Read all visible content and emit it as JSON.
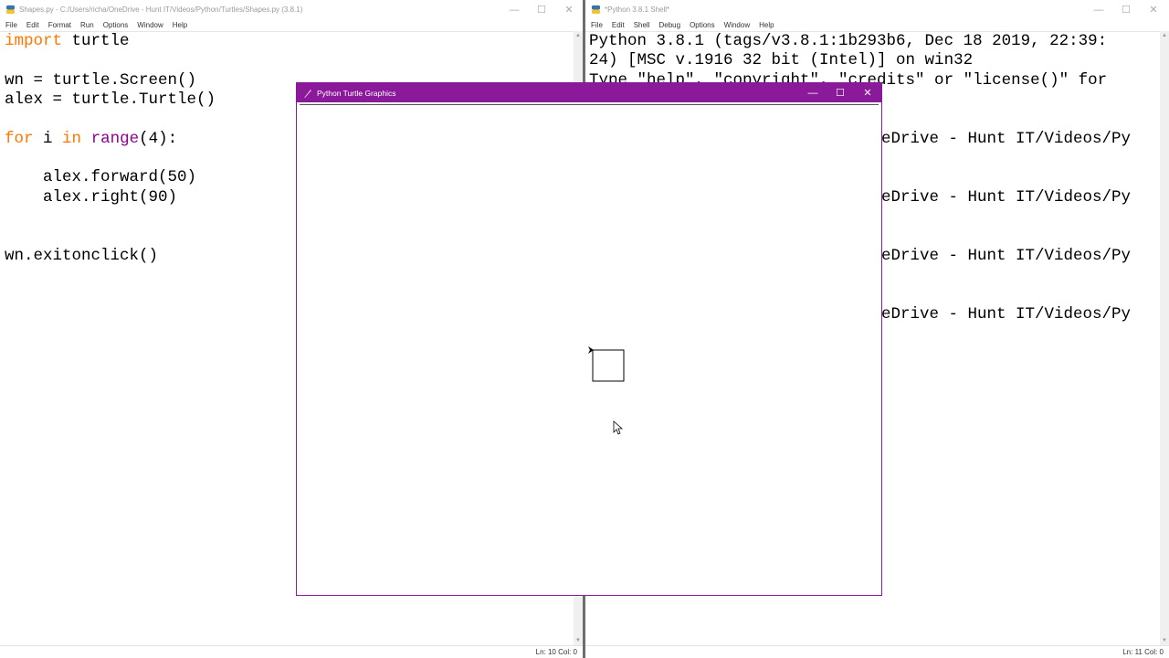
{
  "editor": {
    "title": "Shapes.py - C:/Users/richa/OneDrive - Hunt IT/Videos/Python/Turtles/Shapes.py (3.8.1)",
    "menu": [
      "File",
      "Edit",
      "Format",
      "Run",
      "Options",
      "Window",
      "Help"
    ],
    "code": {
      "l1_kw": "import",
      "l1_rest": " turtle",
      "l3": "wn = turtle.Screen()",
      "l4": "alex = turtle.Turtle()",
      "l6_kw1": "for",
      "l6_mid": " i ",
      "l6_kw2": "in",
      "l6_sp": " ",
      "l6_bi": "range",
      "l6_rest": "(4):",
      "l8": "    alex.forward(50)",
      "l9": "    alex.right(90)",
      "l12": "wn.exitonclick()"
    },
    "status": "Ln: 10   Col: 0"
  },
  "shell": {
    "title": "*Python 3.8.1 Shell*",
    "menu": [
      "File",
      "Edit",
      "Shell",
      "Debug",
      "Options",
      "Window",
      "Help"
    ],
    "lines": {
      "l1": "Python 3.8.1 (tags/v3.8.1:1b293b6, Dec 18 2019, 22:39:",
      "l2": "24) [MSC v.1916 32 bit (Intel)] on win32",
      "l3": "Type \"help\", \"copyright\", \"credits\" or \"license()\" for",
      "r1": "eDrive - Hunt IT/Videos/Py",
      "r2": "eDrive - Hunt IT/Videos/Py",
      "r3": "eDrive - Hunt IT/Videos/Py",
      "r4": "eDrive - Hunt IT/Videos/Py"
    },
    "status": "Ln: 11   Col: 0"
  },
  "turtle_window": {
    "title": "Python Turtle Graphics",
    "accent": "#8a1a9a"
  },
  "controls": {
    "minimize": "—",
    "maximize": "☐",
    "close": "✕"
  }
}
